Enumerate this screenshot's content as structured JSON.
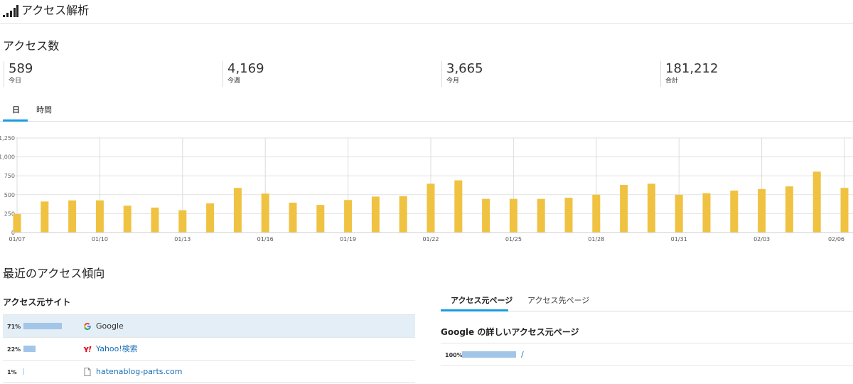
{
  "header": {
    "title": "アクセス解析",
    "icon": "signal-bars-icon"
  },
  "access_count": {
    "title": "アクセス数",
    "stats": [
      {
        "value": "589",
        "label": "今日"
      },
      {
        "value": "4,169",
        "label": "今週"
      },
      {
        "value": "3,665",
        "label": "今月"
      },
      {
        "value": "181,212",
        "label": "合計"
      }
    ]
  },
  "period_tabs": [
    {
      "label": "日",
      "active": true
    },
    {
      "label": "時間",
      "active": false
    }
  ],
  "colors": {
    "bar": "#f0c242",
    "accent": "#1a9be0",
    "source_bar": "#a3c6e8",
    "link": "#1a6fb5",
    "highlight_row": "#e3eef6"
  },
  "chart_data": {
    "type": "bar",
    "categories": [
      "01/07",
      "01/08",
      "01/09",
      "01/10",
      "01/11",
      "01/12",
      "01/13",
      "01/14",
      "01/15",
      "01/16",
      "01/17",
      "01/18",
      "01/19",
      "01/20",
      "01/21",
      "01/22",
      "01/23",
      "01/24",
      "01/25",
      "01/26",
      "01/27",
      "01/28",
      "01/29",
      "01/30",
      "01/31",
      "02/01",
      "02/02",
      "02/03",
      "02/04",
      "02/05",
      "02/06"
    ],
    "values": [
      245,
      410,
      425,
      425,
      355,
      330,
      295,
      385,
      590,
      515,
      395,
      365,
      430,
      475,
      480,
      645,
      690,
      445,
      445,
      445,
      460,
      500,
      630,
      645,
      500,
      520,
      555,
      575,
      610,
      805,
      590
    ],
    "tick_labels": [
      "01/07",
      "01/10",
      "01/13",
      "01/16",
      "01/19",
      "01/22",
      "01/25",
      "01/28",
      "01/31",
      "02/03",
      "02/06"
    ],
    "yticks": [
      "0",
      "250",
      "500",
      "750",
      "1,000",
      "1,250"
    ],
    "ylim": [
      0,
      1250
    ],
    "grid": true
  },
  "trends": {
    "title": "最近のアクセス傾向",
    "sources_title": "アクセス元サイト",
    "sources": [
      {
        "pct": "71%",
        "fraction": 0.71,
        "name": "Google",
        "icon": "google-icon",
        "highlight": true
      },
      {
        "pct": "22%",
        "fraction": 0.22,
        "name": "Yahoo!検索",
        "icon": "yahoo-icon",
        "highlight": false
      },
      {
        "pct": "1%",
        "fraction": 0.01,
        "name": "hatenablog-parts.com",
        "icon": "document-icon",
        "highlight": false
      }
    ],
    "page_tabs": [
      {
        "label": "アクセス元ページ",
        "active": true
      },
      {
        "label": "アクセス先ページ",
        "active": false
      }
    ],
    "detail_title": "Google の詳しいアクセス元ページ",
    "pages": [
      {
        "pct": "100%",
        "fraction": 1.0,
        "name": "/"
      }
    ]
  }
}
